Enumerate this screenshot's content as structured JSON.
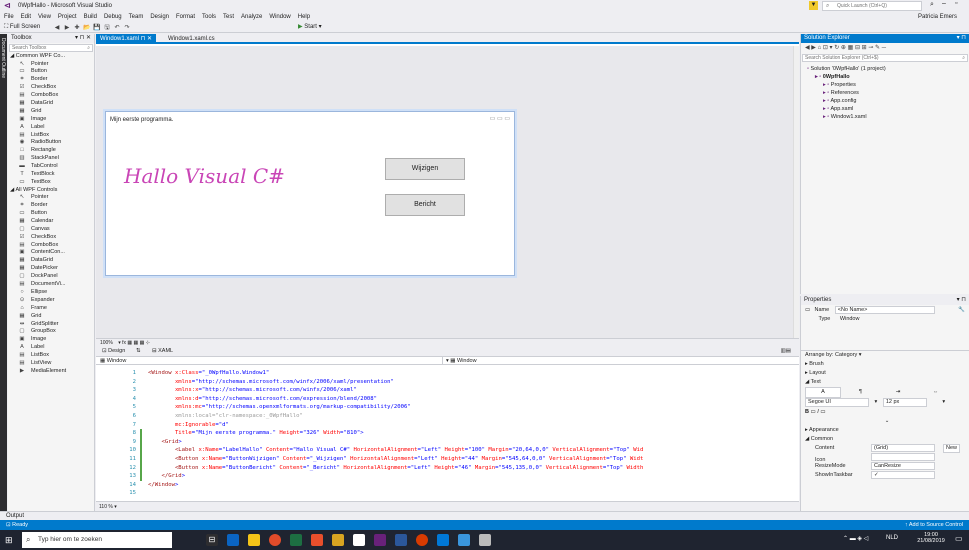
{
  "window": {
    "title": "0WpfHallo - Microsoft Visual Studio",
    "quick_launch_placeholder": "Quick Launch (Ctrl+Q)",
    "user": "Patricia Emers",
    "menu": [
      "File",
      "Edit",
      "View",
      "Project",
      "Build",
      "Debug",
      "Team",
      "Design",
      "Format",
      "Tools",
      "Test",
      "Analyze",
      "Window",
      "Help"
    ],
    "toolbar_fullscreen": "Full Screen",
    "toolbar_start": "Start"
  },
  "outline_strip": "Document Outline",
  "toolbox": {
    "title": "Toolbox",
    "search_placeholder": "Search Toolbox",
    "group1": "Common WPF Co...",
    "group1_items": [
      {
        "label": "Pointer",
        "icon": "pointer-icon",
        "glyph": "↖"
      },
      {
        "label": "Button",
        "icon": "button-icon",
        "glyph": "▭"
      },
      {
        "label": "Border",
        "icon": "border-icon",
        "glyph": "⌗"
      },
      {
        "label": "CheckBox",
        "icon": "checkbox-icon",
        "glyph": "☑"
      },
      {
        "label": "ComboBox",
        "icon": "combobox-icon",
        "glyph": "▤"
      },
      {
        "label": "DataGrid",
        "icon": "datagrid-icon",
        "glyph": "▦"
      },
      {
        "label": "Grid",
        "icon": "grid-icon",
        "glyph": "▦"
      },
      {
        "label": "Image",
        "icon": "image-icon",
        "glyph": "▣"
      },
      {
        "label": "Label",
        "icon": "label-icon",
        "glyph": "A"
      },
      {
        "label": "ListBox",
        "icon": "listbox-icon",
        "glyph": "▤"
      },
      {
        "label": "RadioButton",
        "icon": "radiobutton-icon",
        "glyph": "◉"
      },
      {
        "label": "Rectangle",
        "icon": "rectangle-icon",
        "glyph": "□"
      },
      {
        "label": "StackPanel",
        "icon": "stackpanel-icon",
        "glyph": "▥"
      },
      {
        "label": "TabControl",
        "icon": "tabcontrol-icon",
        "glyph": "▬"
      },
      {
        "label": "TextBlock",
        "icon": "textblock-icon",
        "glyph": "T"
      },
      {
        "label": "TextBox",
        "icon": "textbox-icon",
        "glyph": "▭"
      }
    ],
    "group2": "All WPF Controls",
    "group2_items": [
      {
        "label": "Pointer",
        "icon": "pointer-icon",
        "glyph": "↖"
      },
      {
        "label": "Border",
        "icon": "border-icon",
        "glyph": "⌗"
      },
      {
        "label": "Button",
        "icon": "button-icon",
        "glyph": "▭"
      },
      {
        "label": "Calendar",
        "icon": "calendar-icon",
        "glyph": "▦"
      },
      {
        "label": "Canvas",
        "icon": "canvas-icon",
        "glyph": "▢"
      },
      {
        "label": "CheckBox",
        "icon": "checkbox-icon",
        "glyph": "☑"
      },
      {
        "label": "ComboBox",
        "icon": "combobox-icon",
        "glyph": "▤"
      },
      {
        "label": "ContentCon...",
        "icon": "contentcontrol-icon",
        "glyph": "▣"
      },
      {
        "label": "DataGrid",
        "icon": "datagrid-icon",
        "glyph": "▦"
      },
      {
        "label": "DatePicker",
        "icon": "datepicker-icon",
        "glyph": "▦"
      },
      {
        "label": "DockPanel",
        "icon": "dockpanel-icon",
        "glyph": "▢"
      },
      {
        "label": "DocumentVi...",
        "icon": "documentviewer-icon",
        "glyph": "▤"
      },
      {
        "label": "Ellipse",
        "icon": "ellipse-icon",
        "glyph": "○"
      },
      {
        "label": "Expander",
        "icon": "expander-icon",
        "glyph": "⊙"
      },
      {
        "label": "Frame",
        "icon": "frame-icon",
        "glyph": "⌂"
      },
      {
        "label": "Grid",
        "icon": "grid-icon",
        "glyph": "▦"
      },
      {
        "label": "GridSplitter",
        "icon": "gridsplitter-icon",
        "glyph": "⇹"
      },
      {
        "label": "GroupBox",
        "icon": "groupbox-icon",
        "glyph": "▢"
      },
      {
        "label": "Image",
        "icon": "image-icon",
        "glyph": "▣"
      },
      {
        "label": "Label",
        "icon": "label-icon",
        "glyph": "A"
      },
      {
        "label": "ListBox",
        "icon": "listbox-icon",
        "glyph": "▤"
      },
      {
        "label": "ListView",
        "icon": "listview-icon",
        "glyph": "▤"
      },
      {
        "label": "MediaElement",
        "icon": "mediaelement-icon",
        "glyph": "▶"
      }
    ]
  },
  "tabs": [
    {
      "label": "Window1.xaml",
      "active": true
    },
    {
      "label": "Window1.xaml.cs",
      "active": false
    }
  ],
  "designer": {
    "window_title": "Mijn eerste programma.",
    "label_text": "Hallo Visual C#",
    "button1": "Wijzigen",
    "button2": "Bericht",
    "label_color": "#c945b6"
  },
  "zoom": "100%",
  "view_tabs": {
    "design": "Design",
    "xaml": "XAML"
  },
  "element_bar": {
    "left": "Window",
    "right": "Window"
  },
  "code_lines": [
    {
      "n": "1",
      "parts": [
        [
          "tag",
          "<Window "
        ],
        [
          "attr",
          "x:Class"
        ],
        [
          "punc",
          "=\""
        ],
        [
          "val",
          "_0WpfHallo.Window1"
        ],
        [
          "punc",
          "\""
        ]
      ]
    },
    {
      "n": "2",
      "parts": [
        [
          "attr",
          "        xmlns"
        ],
        [
          "punc",
          "=\""
        ],
        [
          "val",
          "http://schemas.microsoft.com/winfx/2006/xaml/presentation"
        ],
        [
          "punc",
          "\""
        ]
      ]
    },
    {
      "n": "3",
      "parts": [
        [
          "attr",
          "        xmlns:x"
        ],
        [
          "punc",
          "=\""
        ],
        [
          "val",
          "http://schemas.microsoft.com/winfx/2006/xaml"
        ],
        [
          "punc",
          "\""
        ]
      ]
    },
    {
      "n": "4",
      "parts": [
        [
          "attr",
          "        xmlns:d"
        ],
        [
          "punc",
          "=\""
        ],
        [
          "val",
          "http://schemas.microsoft.com/expression/blend/2008"
        ],
        [
          "punc",
          "\""
        ]
      ]
    },
    {
      "n": "5",
      "parts": [
        [
          "attr",
          "        xmlns:mc"
        ],
        [
          "punc",
          "=\""
        ],
        [
          "val",
          "http://schemas.openxmlformats.org/markup-compatibility/2006"
        ],
        [
          "punc",
          "\""
        ]
      ]
    },
    {
      "n": "6",
      "parts": [
        [
          "dim",
          "        xmlns:local=\"clr-namespace:_0WpfHallo\""
        ]
      ]
    },
    {
      "n": "7",
      "parts": [
        [
          "attr",
          "        mc:Ignorable"
        ],
        [
          "punc",
          "=\""
        ],
        [
          "val",
          "d"
        ],
        [
          "punc",
          "\""
        ]
      ]
    },
    {
      "n": "8",
      "parts": [
        [
          "attr",
          "        Title"
        ],
        [
          "punc",
          "=\""
        ],
        [
          "val",
          "Mijn eerste programma."
        ],
        [
          "punc",
          "\" "
        ],
        [
          "attr",
          "Height"
        ],
        [
          "punc",
          "=\""
        ],
        [
          "val",
          "326"
        ],
        [
          "punc",
          "\" "
        ],
        [
          "attr",
          "Width"
        ],
        [
          "punc",
          "=\""
        ],
        [
          "val",
          "810"
        ],
        [
          "punc",
          "\">"
        ]
      ]
    },
    {
      "n": "9",
      "parts": [
        [
          "tag",
          "    <Grid"
        ],
        [
          "punc",
          ">"
        ]
      ]
    },
    {
      "n": "10",
      "parts": [
        [
          "tag",
          "        <Label "
        ],
        [
          "attr",
          "x:Name"
        ],
        [
          "punc",
          "=\""
        ],
        [
          "val",
          "LabelHallo"
        ],
        [
          "punc",
          "\" "
        ],
        [
          "attr",
          "Content"
        ],
        [
          "punc",
          "=\""
        ],
        [
          "val",
          "Hallo Visual C#"
        ],
        [
          "punc",
          "\" "
        ],
        [
          "attr",
          "HorizontalAlignment"
        ],
        [
          "punc",
          "=\""
        ],
        [
          "val",
          "Left"
        ],
        [
          "punc",
          "\" "
        ],
        [
          "attr",
          "Height"
        ],
        [
          "punc",
          "=\""
        ],
        [
          "val",
          "100"
        ],
        [
          "punc",
          "\" "
        ],
        [
          "attr",
          "Margin"
        ],
        [
          "punc",
          "=\""
        ],
        [
          "val",
          "20,64,0,0"
        ],
        [
          "punc",
          "\" "
        ],
        [
          "attr",
          "VerticalAlignment"
        ],
        [
          "punc",
          "=\""
        ],
        [
          "val",
          "Top"
        ],
        [
          "punc",
          "\" "
        ],
        [
          "attr",
          "Wid"
        ]
      ]
    },
    {
      "n": "11",
      "parts": [
        [
          "tag",
          "        <Button "
        ],
        [
          "attr",
          "x:Name"
        ],
        [
          "punc",
          "=\""
        ],
        [
          "val",
          "ButtonWijzigen"
        ],
        [
          "punc",
          "\" "
        ],
        [
          "attr",
          "Content"
        ],
        [
          "punc",
          "=\""
        ],
        [
          "val",
          "_Wijzigen"
        ],
        [
          "punc",
          "\" "
        ],
        [
          "attr",
          "HorizontalAlignment"
        ],
        [
          "punc",
          "=\""
        ],
        [
          "val",
          "Left"
        ],
        [
          "punc",
          "\" "
        ],
        [
          "attr",
          "Height"
        ],
        [
          "punc",
          "=\""
        ],
        [
          "val",
          "44"
        ],
        [
          "punc",
          "\" "
        ],
        [
          "attr",
          "Margin"
        ],
        [
          "punc",
          "=\""
        ],
        [
          "val",
          "545,64,0,0"
        ],
        [
          "punc",
          "\" "
        ],
        [
          "attr",
          "VerticalAlignment"
        ],
        [
          "punc",
          "=\""
        ],
        [
          "val",
          "Top"
        ],
        [
          "punc",
          "\" "
        ],
        [
          "attr",
          "Widt"
        ]
      ]
    },
    {
      "n": "12",
      "parts": [
        [
          "tag",
          "        <Button "
        ],
        [
          "attr",
          "x:Name"
        ],
        [
          "punc",
          "=\""
        ],
        [
          "val",
          "ButtonBericht"
        ],
        [
          "punc",
          "\" "
        ],
        [
          "attr",
          "Content"
        ],
        [
          "punc",
          "=\""
        ],
        [
          "val",
          "_Bericht"
        ],
        [
          "punc",
          "\" "
        ],
        [
          "attr",
          "HorizontalAlignment"
        ],
        [
          "punc",
          "=\""
        ],
        [
          "val",
          "Left"
        ],
        [
          "punc",
          "\" "
        ],
        [
          "attr",
          "Height"
        ],
        [
          "punc",
          "=\""
        ],
        [
          "val",
          "46"
        ],
        [
          "punc",
          "\" "
        ],
        [
          "attr",
          "Margin"
        ],
        [
          "punc",
          "=\""
        ],
        [
          "val",
          "545,135,0,0"
        ],
        [
          "punc",
          "\" "
        ],
        [
          "attr",
          "VerticalAlignment"
        ],
        [
          "punc",
          "=\""
        ],
        [
          "val",
          "Top"
        ],
        [
          "punc",
          "\" "
        ],
        [
          "attr",
          "Width"
        ]
      ]
    },
    {
      "n": "13",
      "parts": [
        [
          "tag",
          "    </Grid"
        ],
        [
          "punc",
          ">"
        ]
      ]
    },
    {
      "n": "14",
      "parts": [
        [
          "tag",
          "</Window"
        ],
        [
          "punc",
          ">"
        ]
      ]
    },
    {
      "n": "15",
      "parts": []
    }
  ],
  "code_zoom": "110 %",
  "solution_explorer": {
    "title": "Solution Explorer",
    "search_placeholder": "Search Solution Explorer (Ctrl+$)",
    "items": [
      {
        "label": "Solution '0WpfHallo' (1 project)",
        "indent": 0,
        "icon": "solution-icon"
      },
      {
        "label": "0WpfHallo",
        "indent": 1,
        "icon": "csharp-project-icon",
        "selected": true
      },
      {
        "label": "Properties",
        "indent": 2,
        "icon": "wrench-icon"
      },
      {
        "label": "References",
        "indent": 2,
        "icon": "references-icon"
      },
      {
        "label": "App.config",
        "indent": 2,
        "icon": "config-file-icon"
      },
      {
        "label": "App.xaml",
        "indent": 2,
        "icon": "xaml-file-icon"
      },
      {
        "label": "Window1.xaml",
        "indent": 2,
        "icon": "xaml-file-icon"
      }
    ]
  },
  "properties": {
    "title": "Properties",
    "name_label": "Name",
    "name_value": "<No Name>",
    "type_label": "Type",
    "type_value": "Window",
    "arrange_by": "Arrange by: Category",
    "brush": "Brush",
    "layout": "Layout",
    "text": "Text",
    "font_family": "Segoe UI",
    "font_size": "12 px",
    "appearance": "Appearance",
    "common": "Common",
    "rows": [
      {
        "label": "Content",
        "value": "(Grid)",
        "button": "New"
      },
      {
        "label": "Icon",
        "value": ""
      },
      {
        "label": "ResizeMode",
        "value": "CanResize"
      },
      {
        "label": "ShowInTaskbar",
        "value": "✓"
      }
    ]
  },
  "output_label": "Output",
  "status": {
    "left": "Ready",
    "right": "Add to Source Control"
  },
  "taskbar": {
    "search_placeholder": "Typ hier om te zoeken",
    "lang": "NLD",
    "time": "19:00",
    "date": "21/08/2019"
  },
  "colors": {
    "accent": "#007acc",
    "taskbar": "#1f2430"
  }
}
